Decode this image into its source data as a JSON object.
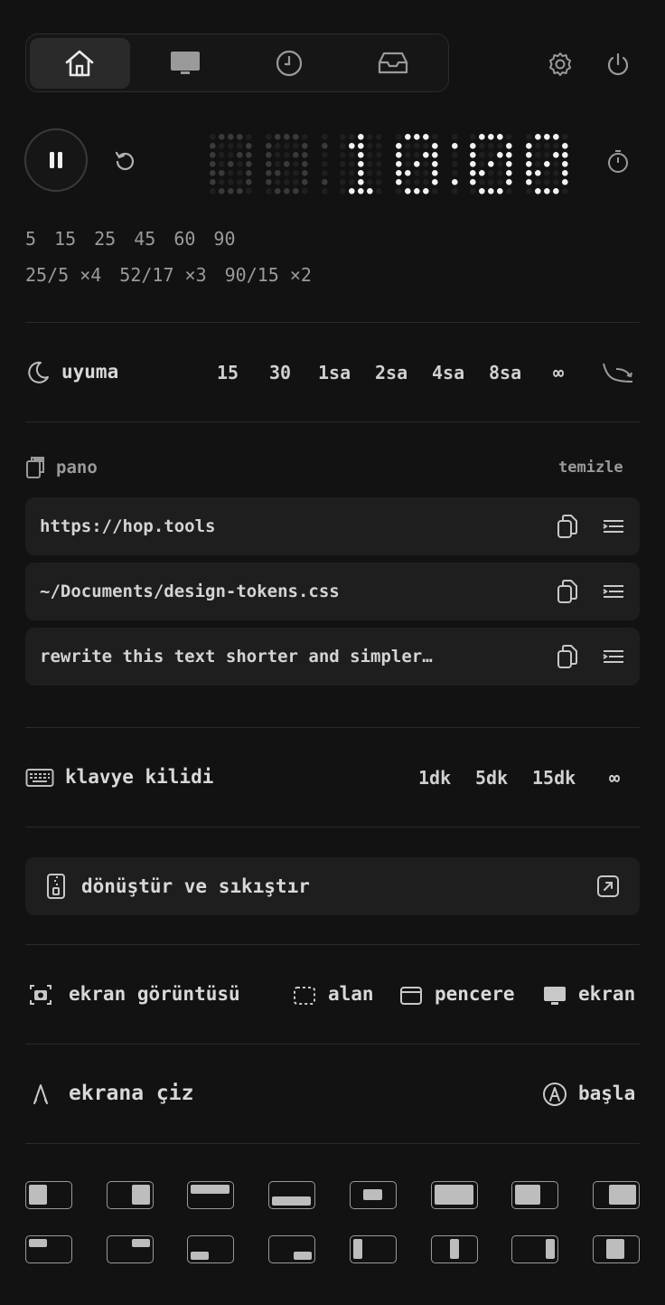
{
  "nav": {
    "tabs": [
      {
        "name": "home-icon",
        "active": true
      },
      {
        "name": "monitor-icon",
        "active": false
      },
      {
        "name": "clock-icon",
        "active": false
      },
      {
        "name": "inbox-icon",
        "active": false
      }
    ]
  },
  "timer": {
    "minutes_dim": "00",
    "separator_dim": ":",
    "display": "10:00",
    "presets_row1": [
      "5",
      "15",
      "25",
      "45",
      "60",
      "90"
    ],
    "presets_row2": [
      "25/5 ×4",
      "52/17 ×3",
      "90/15 ×2"
    ]
  },
  "sleep": {
    "label": "uyuma",
    "options": [
      "15",
      "30",
      "1sa",
      "2sa",
      "4sa",
      "8sa",
      "∞"
    ]
  },
  "clipboard": {
    "label": "pano",
    "clear_label": "temizle",
    "items": [
      "https://hop.tools",
      "~/Documents/design-tokens.css",
      "rewrite this text shorter and simpler…"
    ]
  },
  "keyboard_lock": {
    "label": "klavye kilidi",
    "options": [
      "1dk",
      "5dk",
      "15dk",
      "∞"
    ]
  },
  "convert": {
    "label": "dönüştür ve sıkıştır"
  },
  "screenshot": {
    "label": "ekran görüntüsü",
    "area": "alan",
    "window": "pencere",
    "screen": "ekran"
  },
  "draw": {
    "label": "ekrana çiz",
    "start": "başla"
  },
  "colors": {
    "background": "#121212",
    "surface": "#1e1e1e",
    "text": "#d8d8d8",
    "muted": "#9a9a9a"
  }
}
